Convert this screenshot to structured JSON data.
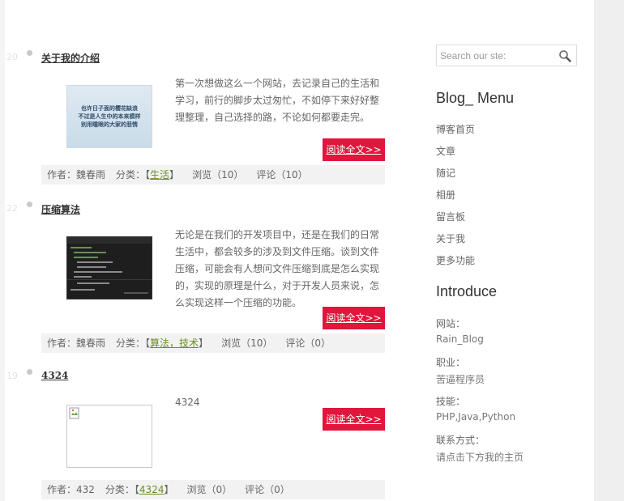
{
  "posts": [
    {
      "day": "20",
      "title": "关于我的介绍",
      "thumb_text": [
        "也许日子面的樱花缺浪",
        "不过是人生中的本来模样",
        "别用瞳眼的大家的悲情"
      ],
      "excerpt": "第一次想做这么一个网站，去记录自己的生活和学习，前行的脚步太过匆忙，不如停下来好好整理整理，自己选择的路，不论如何都要走完。",
      "read_more": "阅读全文>>",
      "meta": {
        "author": "作者：魏春雨",
        "cat_prefix": "分类：【",
        "cat": "生活",
        "cat_suffix": "】",
        "views": "浏览（10）",
        "comments": "评论（10）"
      }
    },
    {
      "day": "22",
      "title": "压缩算法",
      "excerpt": "无论是在我们的开发项目中，还是在我们的日常生活中，都会较多的涉及到文件压缩。谈到文件压缩，可能会有人想问文件压缩到底是怎么实现的，实现的原理是什么，对于开发人员来说，怎么实现这样一个压缩的功能。",
      "read_more": "阅读全文>>",
      "meta": {
        "author": "作者：魏春雨",
        "cat_prefix": "分类：【",
        "cat": "算法，技术",
        "cat_suffix": "】",
        "views": "浏览（10）",
        "comments": "评论（0）"
      }
    },
    {
      "day": "19",
      "title": "4324",
      "excerpt": "4324",
      "read_more": "阅读全文>>",
      "meta": {
        "author": "作者：432",
        "cat_prefix": "分类：【",
        "cat": "4324",
        "cat_suffix": "】",
        "views": "浏览（0）",
        "comments": "评论（0）"
      }
    }
  ],
  "sidebar": {
    "search_placeholder": "Search our ste:",
    "menu_title": "Blog_ Menu",
    "menu": [
      "博客首页",
      "文章",
      "随记",
      "相册",
      "留言板",
      "关于我",
      "更多功能"
    ],
    "intro_title": "Introduce",
    "intro": [
      {
        "label": "网站：",
        "value": "Rain_Blog"
      },
      {
        "label": "职业：",
        "value": "苦逼程序员"
      },
      {
        "label": "技能：",
        "value": "PHP,Java,Python"
      },
      {
        "label": "联系方式：",
        "value": "请点击下方我的主页"
      }
    ]
  },
  "colors": {
    "accent": "#e0163c",
    "category_link": "#6b8e23",
    "meta_bg": "#f2f2f2"
  }
}
